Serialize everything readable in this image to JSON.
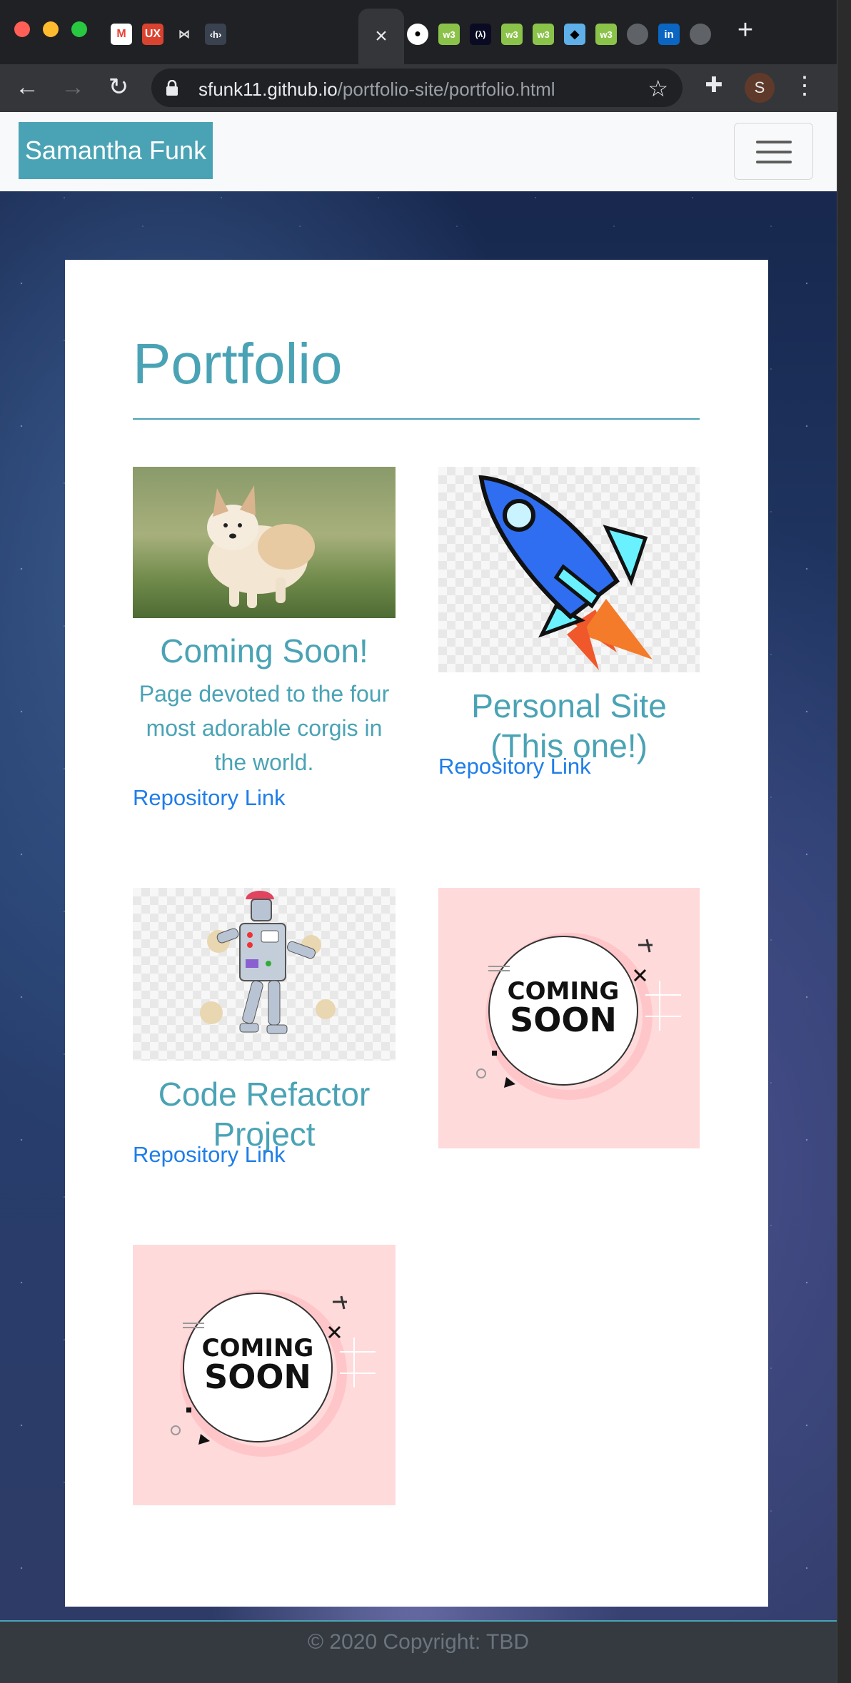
{
  "browser": {
    "url_host": "sfunk11.github.io",
    "url_path": "/portfolio-site/portfolio.html",
    "profile_initial": "S",
    "tab_close": "×",
    "tabs": [
      {
        "icon": "gmail-icon"
      },
      {
        "icon": "ux-icon",
        "text": "UX"
      },
      {
        "icon": "bowtie-icon"
      },
      {
        "icon": "hackerrank-icon",
        "text": "‹h›"
      },
      {
        "icon": "globe-icon"
      },
      {
        "icon": "zoom-icon"
      },
      {
        "icon": "globe-icon"
      },
      {
        "icon": "gitlab-icon"
      },
      {
        "icon": "github-icon"
      },
      {
        "icon": "w3schools-icon",
        "text": "w3"
      },
      {
        "icon": "freecodecamp-icon",
        "text": "(λ)"
      },
      {
        "icon": "w3schools-icon",
        "text": "w3"
      },
      {
        "icon": "w3schools-icon",
        "text": "w3"
      },
      {
        "icon": "codepen-icon"
      },
      {
        "icon": "w3schools-icon",
        "text": "w3"
      },
      {
        "icon": "globe-icon"
      },
      {
        "icon": "linkedin-icon",
        "text": "in"
      },
      {
        "icon": "globe-icon"
      }
    ]
  },
  "navbar": {
    "brand": "Samantha Funk"
  },
  "page": {
    "heading": "Portfolio",
    "projects": [
      {
        "title": "Coming Soon!",
        "description": "Page devoted to the four most adorable corgis in the world.",
        "link": "Repository Link",
        "image": "corgi-puppy-image"
      },
      {
        "title": "Personal Site (This one!)",
        "link": "Repository Link",
        "image": "rocket-image"
      },
      {
        "title": "Code Refactor Project",
        "link": "Repository Link",
        "image": "robot-image"
      },
      {
        "image": "coming-soon-image",
        "image_text_top": "COMING",
        "image_text_bottom": "SOON"
      },
      {
        "image": "coming-soon-image",
        "image_text_top": "COMING",
        "image_text_bottom": "SOON"
      }
    ]
  },
  "footer": {
    "text": "© 2020 Copyright: TBD"
  },
  "colors": {
    "accent": "#4aa3b5",
    "link": "#1f7dea",
    "footer_bg": "#343a40"
  }
}
